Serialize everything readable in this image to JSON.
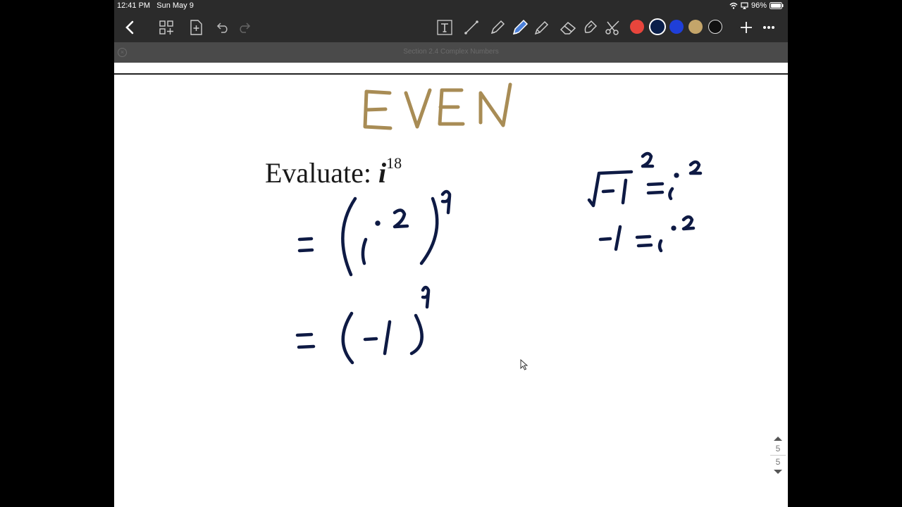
{
  "status_bar": {
    "time": "12:41 PM",
    "date": "Sun May 9",
    "battery": "96%",
    "icons": [
      "wifi-icon",
      "screen-mirror-icon",
      "battery-icon"
    ]
  },
  "toolbar": {
    "left_icons": [
      "back-chevron-icon",
      "grid-add-icon",
      "page-add-icon",
      "undo-icon",
      "redo-icon"
    ],
    "tools": [
      "text-tool-icon",
      "lasso-line-icon",
      "pen-icon",
      "highlighter-pen-icon",
      "marker-icon",
      "eraser-icon",
      "shape-icon",
      "scissors-icon"
    ],
    "colors": [
      "#e8453c",
      "#0a1f4a",
      "#1f3fd8",
      "#c4a56a",
      "#111111"
    ],
    "selected_color": "#0a1f4a",
    "right_icons": [
      "plus-icon",
      "more-icon"
    ]
  },
  "document": {
    "title": "Section 2.4 Complex Numbers",
    "heading_handwritten": "EVEN",
    "problem_label": "Evaluate:",
    "problem_var": "i",
    "problem_exp": "18",
    "work_lines": [
      "= (i²)⁹",
      "= (-1)⁹"
    ],
    "side_notes": [
      "√-1 = i",
      "-1 = i²"
    ],
    "ink_color": "#0e1a44",
    "heading_color": "#a88c55"
  },
  "pager": {
    "current": "5",
    "total": "5"
  }
}
